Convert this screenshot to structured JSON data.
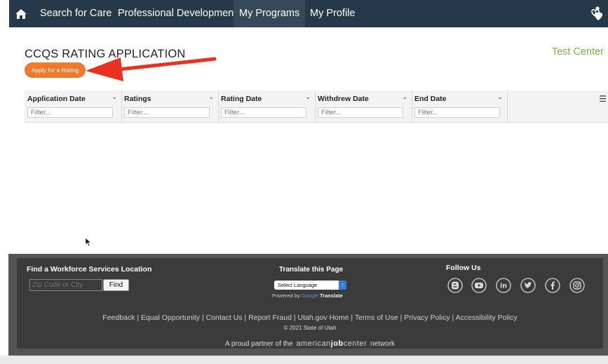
{
  "nav": {
    "items": [
      {
        "label": "Search for Care"
      },
      {
        "label": "Professional Development"
      },
      {
        "label": "My Programs"
      },
      {
        "label": "My Profile"
      }
    ]
  },
  "page": {
    "title": "CCQS RATING APPLICATION",
    "center_name": "Test Center",
    "apply_button": "Apply for a Rating"
  },
  "grid": {
    "columns": [
      {
        "header": "Application Date",
        "filter_placeholder": "Filter..."
      },
      {
        "header": "Ratings",
        "filter_placeholder": "Filter..."
      },
      {
        "header": "Rating Date",
        "filter_placeholder": "Filter..."
      },
      {
        "header": "Withdrew Date",
        "filter_placeholder": "Filter..."
      },
      {
        "header": "End Date",
        "filter_placeholder": "Filter..."
      }
    ]
  },
  "footer": {
    "workforce_title": "Find a Workforce Services Location",
    "zip_placeholder": "Zip Code or City",
    "find_button": "Find",
    "translate_title": "Translate this Page",
    "select_language": "Select Language",
    "powered_by": "Powered by",
    "google": "Google",
    "translate": "Translate",
    "follow_title": "Follow Us",
    "links": "Feedback | Equal Opportunity | Contact Us | Report Fraud | Utah.gov Home | Terms of Use | Privacy Policy | Accessibility Policy",
    "copyright": "© 2021 State of Utah",
    "partner_prefix": "A proud partner of the",
    "partner_brand_a": "american",
    "partner_brand_b": "job",
    "partner_brand_c": "center",
    "partner_suffix": "network"
  },
  "colors": {
    "nav_bg": "#26394a",
    "accent_orange": "#f07a2b",
    "center_green": "#7cb342",
    "arrow_red": "#e8321f"
  }
}
